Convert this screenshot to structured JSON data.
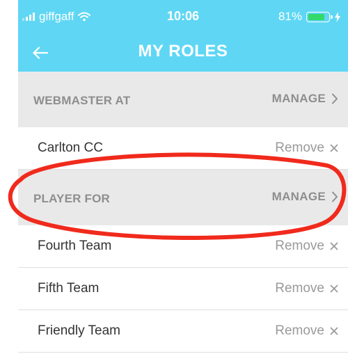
{
  "status_bar": {
    "carrier": "giffgaff",
    "time": "10:06",
    "battery_percent": "81%",
    "battery_level": 0.81,
    "icons": [
      "signal-icon",
      "wifi-icon",
      "battery-icon",
      "charging-icon"
    ]
  },
  "header": {
    "title": "MY ROLES",
    "back_icon": "arrow-left-icon"
  },
  "sections": [
    {
      "label": "WEBMASTER AT",
      "manage_label": "MANAGE",
      "items": [
        {
          "name": "Carlton CC",
          "remove_label": "Remove"
        }
      ]
    },
    {
      "label": "PLAYER FOR",
      "manage_label": "MANAGE",
      "items": [
        {
          "name": "Fourth Team",
          "remove_label": "Remove"
        },
        {
          "name": "Fifth Team",
          "remove_label": "Remove"
        },
        {
          "name": "Friendly Team",
          "remove_label": "Remove"
        }
      ]
    }
  ],
  "colors": {
    "header_bg": "#5fd7f4",
    "section_bg": "#e9e9e9",
    "annotation": "#f02a1c",
    "battery_fill": "#33d96a"
  }
}
